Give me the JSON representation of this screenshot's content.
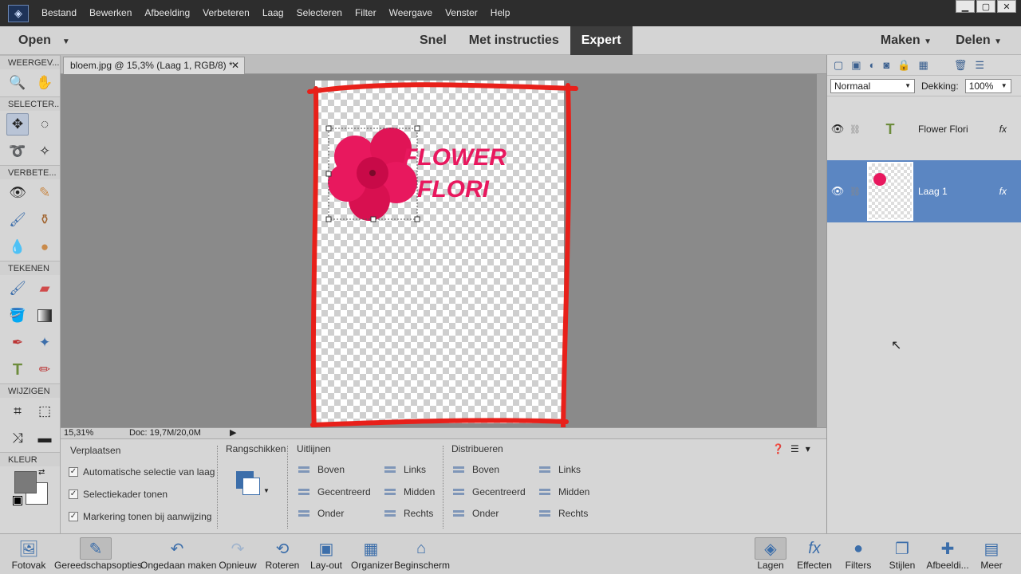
{
  "menu": [
    "Bestand",
    "Bewerken",
    "Afbeelding",
    "Verbeteren",
    "Laag",
    "Selecteren",
    "Filter",
    "Weergave",
    "Venster",
    "Help"
  ],
  "modebar": {
    "open": "Open",
    "modes": [
      "Snel",
      "Met instructies",
      "Expert"
    ],
    "active_mode": "Expert",
    "make": "Maken",
    "share": "Delen"
  },
  "toolbox": {
    "sections": {
      "view": "WEERGEV...",
      "select": "SELECTER...",
      "enhance": "VERBETE...",
      "draw": "TEKENEN",
      "modify": "WIJZIGEN",
      "color": "KLEUR"
    }
  },
  "document": {
    "tab_title": "bloem.jpg @ 15,3% (Laag 1, RGB/8) *",
    "zoom": "15,31%",
    "doc_info": "Doc: 19,7M/20,0M",
    "canvas_text": [
      "FLOWER",
      "FLORI"
    ]
  },
  "options": {
    "move_title": "Verplaatsen",
    "checks": [
      "Automatische selectie van laag",
      "Selectiekader tonen",
      "Markering tonen bij aanwijzing"
    ],
    "arrange_title": "Rangschikken",
    "align_title": "Uitlijnen",
    "align": [
      "Boven",
      "Gecentreerd",
      "Onder",
      "Links",
      "Midden",
      "Rechts"
    ],
    "distribute_title": "Distribueren",
    "distribute": [
      "Boven",
      "Gecentreerd",
      "Onder",
      "Links",
      "Midden",
      "Rechts"
    ]
  },
  "layers": {
    "blend_mode": "Normaal",
    "opacity_label": "Dekking:",
    "opacity": "100%",
    "items": [
      {
        "name": "Flower Flori",
        "fx": "fx"
      },
      {
        "name": "Laag 1",
        "fx": "fx"
      }
    ]
  },
  "bottom": [
    "Fotovak",
    "Gereedschapsopties",
    "Ongedaan maken",
    "Opnieuw",
    "Roteren",
    "Lay-out",
    "Organizer",
    "Beginscherm",
    "Lagen",
    "Effecten",
    "Filters",
    "Stijlen",
    "Afbeeldi...",
    "Meer"
  ],
  "colors": {
    "annotation": "#e8201a",
    "flower": "#e8185e",
    "layer_active": "#5b86c2"
  }
}
